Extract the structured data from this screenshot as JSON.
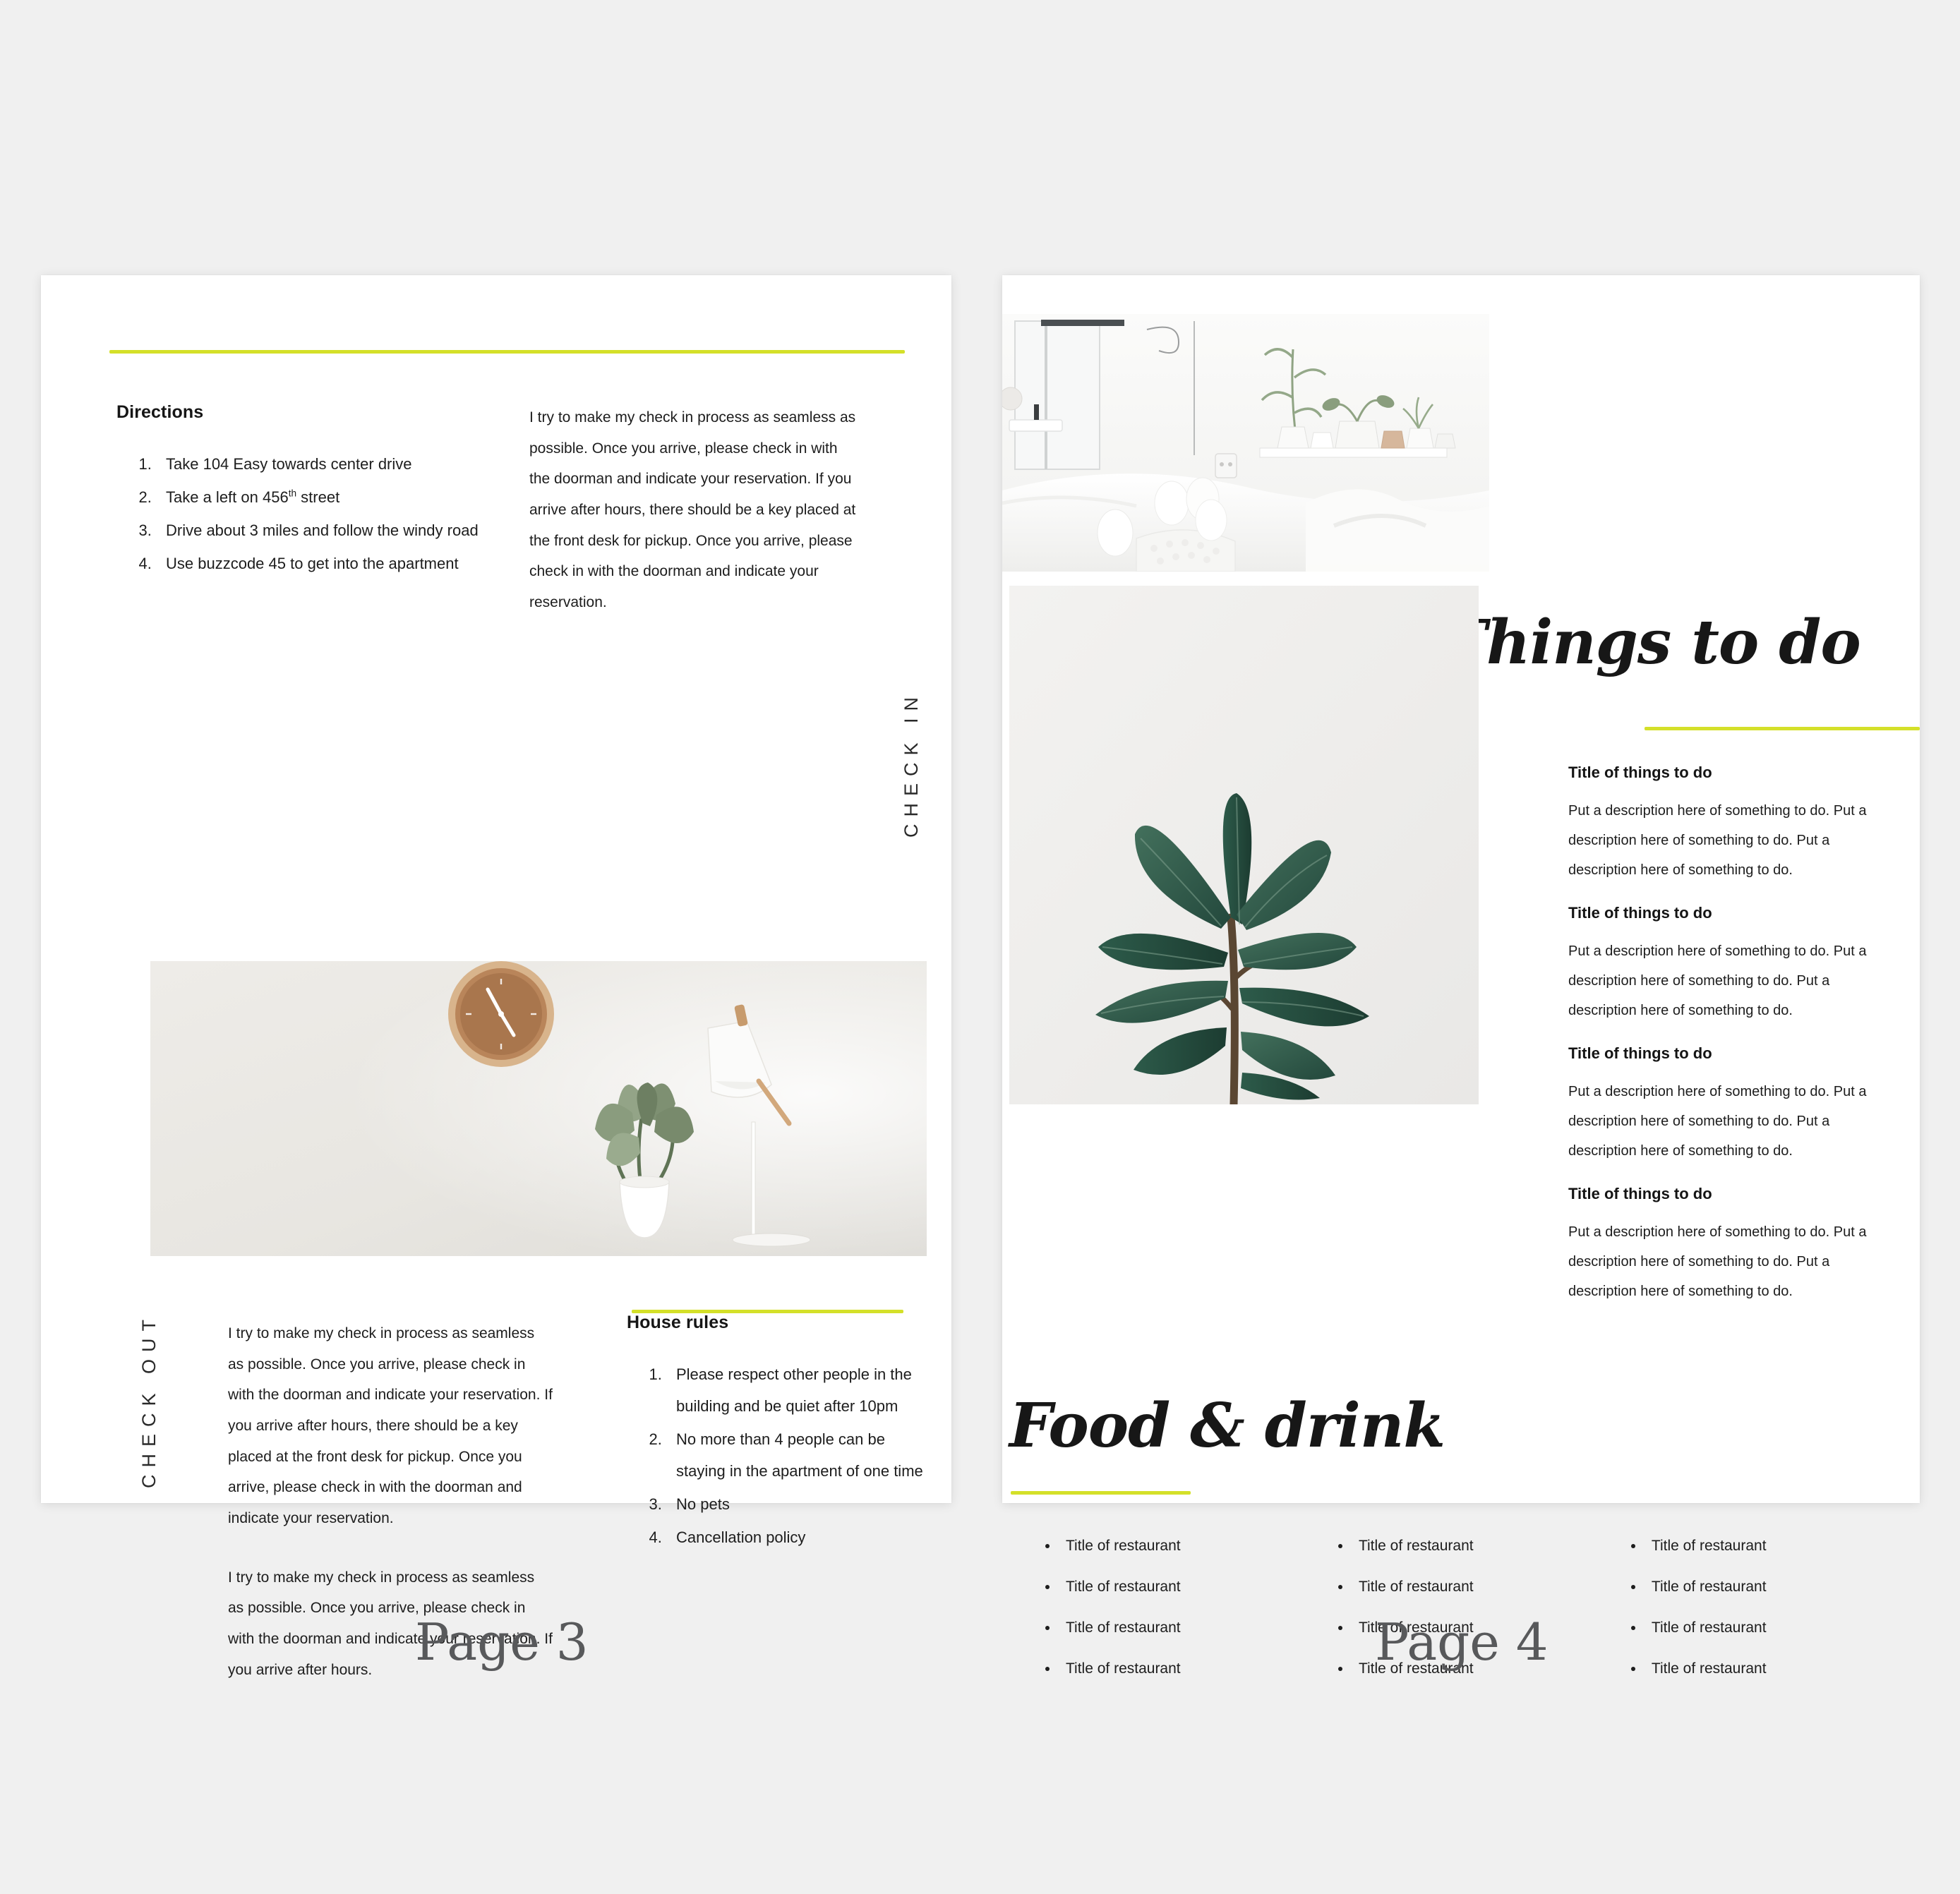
{
  "theme": {
    "accent": "#d4e029",
    "page_bg": "#ffffff",
    "canvas_bg": "#f0f0f0",
    "text": "#1d1d1d"
  },
  "left_page": {
    "caption": "Page 3",
    "directions": {
      "heading": "Directions",
      "items": [
        "Take 104 Easy towards center drive",
        "Take a left on 456|th| street",
        "Drive about 3 miles and follow the windy road",
        "Use buzzcode 45 to get into the apartment"
      ]
    },
    "check_in": {
      "label": "CHECK IN",
      "paragraph": "I try to make my check in process as seamless as possible. Once you arrive, please check in with the doorman and indicate your reservation. If you arrive after hours, there should be a key placed at the front desk for pickup. Once you arrive, please check in with the doorman and indicate your reservation."
    },
    "photo": {
      "name": "interior-photo",
      "description": "White wall with wooden clock, desk lamp and potted plant"
    },
    "check_out": {
      "label": "CHECK OUT",
      "paragraph_1": "I try to make my check in process as seamless as possible. Once you arrive, please check in with the doorman and indicate your reservation. If you arrive after hours, there should be a key placed at the front desk for pickup. Once you arrive, please check in with the doorman and indicate your reservation.",
      "paragraph_2": "I try to make my check in process as seamless as possible. Once you arrive, please check in with the doorman and indicate your reservation. If you arrive after hours."
    },
    "house_rules": {
      "heading": "House rules",
      "items": [
        "Please respect other people in the building and be quiet after 10pm",
        "No more than 4 people can be staying in the apartment of one time",
        "No pets",
        "Cancellation policy"
      ]
    }
  },
  "right_page": {
    "caption": "Page 4",
    "photos": [
      {
        "name": "bedroom-photo",
        "description": "Bright white bedroom with plants on shelf and white bedding"
      },
      {
        "name": "plant-photo",
        "description": "Dark green rubber plant against pale background"
      }
    ],
    "things_to_do": {
      "title": "Things to do",
      "blocks": [
        {
          "title": "Title of things to do",
          "description": "Put a description here of something to do. Put a description here of something to do. Put a description here of something to do."
        },
        {
          "title": "Title of things to do",
          "description": "Put a description here of something to do. Put a description here of something to do. Put a description here of something to do."
        },
        {
          "title": "Title of things to do",
          "description": "Put a description here of something to do. Put a description here of something to do. Put a description here of something to do."
        },
        {
          "title": "Title of things to do",
          "description": "Put a description here of something to do. Put a description here of something to do. Put a description here of something to do."
        }
      ]
    },
    "food_and_drink": {
      "title": "Food & drink",
      "columns": [
        [
          "Title of restaurant",
          "Title of restaurant",
          "Title of restaurant",
          "Title of restaurant"
        ],
        [
          "Title of restaurant",
          "Title of restaurant",
          "Title of restaurant",
          "Title of restaurant"
        ],
        [
          "Title of restaurant",
          "Title of restaurant",
          "Title of restaurant",
          "Title of restaurant"
        ]
      ]
    }
  }
}
